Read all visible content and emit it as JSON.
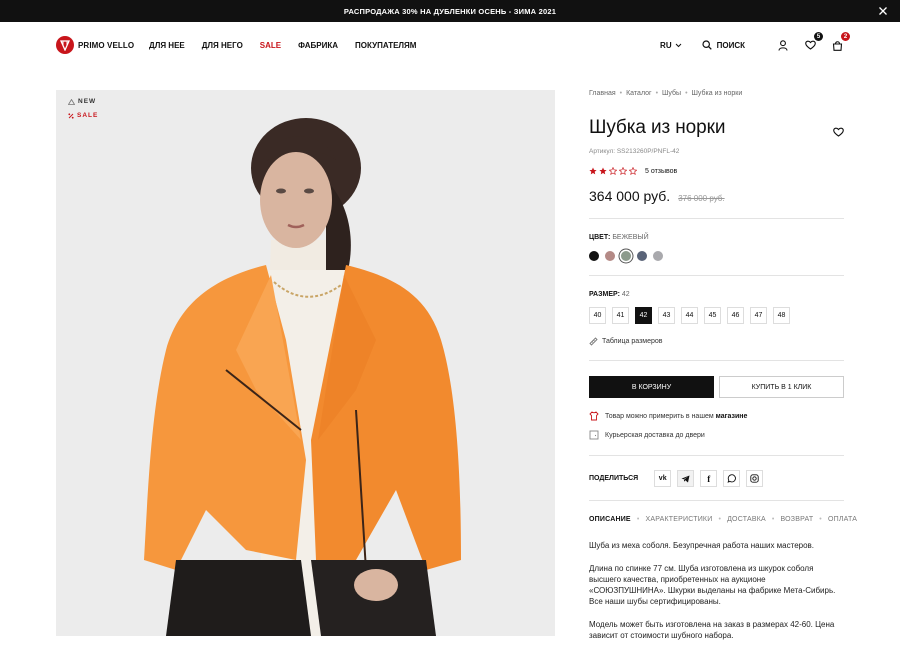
{
  "banner": {
    "text": "РАСПРОДАЖА 30% НА ДУБЛЕНКИ ОСЕНЬ - ЗИМА 2021"
  },
  "brand": {
    "name": "PRIMO VELLO"
  },
  "nav": {
    "items": [
      "ДЛЯ НЕЕ",
      "ДЛЯ НЕГО",
      "SALE",
      "ФАБРИКА",
      "ПОКУПАТЕЛЯМ"
    ]
  },
  "header": {
    "lang": "RU",
    "search_label": "ПОИСК",
    "wishlist_count": "5",
    "cart_count": "2"
  },
  "product_image": {
    "tags": [
      "NEW",
      "SALE"
    ]
  },
  "breadcrumbs": [
    "Главная",
    "Каталог",
    "Шубы",
    "Шубка из норки"
  ],
  "product": {
    "title": "Шубка из норки",
    "sku": "Артикул: SS213260P/PNFL-42",
    "rating": 2,
    "rating_max": 5,
    "reviews": "5 отзывов",
    "price": "364 000 руб.",
    "old_price": "376 000 руб."
  },
  "color": {
    "label": "ЦВЕТ:",
    "value": "БЕЖЕВЫЙ",
    "swatches": [
      "#111111",
      "#b48a86",
      "#8c9a8c",
      "#5a6478",
      "#a9a9ad"
    ],
    "selected_index": 2
  },
  "size": {
    "label": "РАЗМЕР:",
    "value": "42",
    "options": [
      "40",
      "41",
      "42",
      "43",
      "44",
      "45",
      "46",
      "47",
      "48"
    ],
    "selected": "42",
    "table_link": "Таблица размеров"
  },
  "actions": {
    "cart": "В КОРЗИНУ",
    "buy_one_click": "КУПИТЬ В 1 КЛИК"
  },
  "info": {
    "try_on_text": "Товар можно примерить в нашем",
    "try_on_link": "магазине",
    "delivery": "Курьерская доставка до двери"
  },
  "share": {
    "label": "ПОДЕЛИТЬСЯ",
    "networks": [
      "vk-icon",
      "telegram-icon",
      "facebook-icon",
      "whatsapp-icon",
      "instagram-icon"
    ]
  },
  "tabs": [
    "ОПИСАНИЕ",
    "ХАРАКТЕРИСТИКИ",
    "ДОСТАВКА",
    "ВОЗВРАТ",
    "ОПЛАТА"
  ],
  "description": [
    "Шуба из меха соболя. Безупречная работа наших мастеров.",
    "Длина по спинке 77 см. Шуба изготовлена из шкурок соболя высшего качества, приобретенных на аукционе «СОЮЗПУШНИНА». Шкурки выделаны на фабрике Мета-Сибирь. Все наши шубы сертифицированы.",
    "Модель может быть изготовлена на заказ в размерах 42-60. Цена зависит от стоимости шубного набора."
  ],
  "colors": {
    "accent": "#c8151b",
    "dark": "#111111"
  }
}
